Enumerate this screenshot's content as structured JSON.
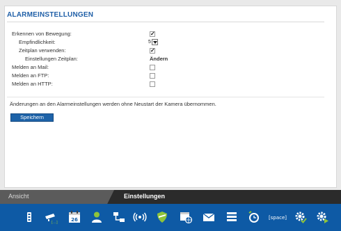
{
  "panel": {
    "title": "ALARMEINSTELLUNGEN",
    "rows": [
      {
        "label": "Erkennen von Bewegung:",
        "control": "checkbox",
        "checked": true,
        "mark": "✓"
      },
      {
        "label": "Empfindlichkeit:",
        "control": "spinner",
        "value": "5"
      },
      {
        "label": "Zeitplan verwenden:",
        "control": "checkbox",
        "checked": true,
        "mark": "✓"
      },
      {
        "label": "Einstellungen Zeitplan:",
        "control": "link",
        "value": "Ändern"
      },
      {
        "label": "Melden an Mail:",
        "control": "checkbox",
        "checked": false,
        "mark": ""
      },
      {
        "label": "Melden an FTP:",
        "control": "checkbox",
        "checked": false,
        "mark": ""
      },
      {
        "label": "Melden an HTTP:",
        "control": "checkbox",
        "checked": false,
        "mark": ""
      }
    ],
    "note": "Änderungen an den Alarmeinstellungen werden ohne Neustart der Kamera übernommen.",
    "save_label": "Speichern"
  },
  "tabs": {
    "inactive": "Ansicht",
    "active": "Einstellungen"
  },
  "toolbar": {
    "icons": [
      "device-info-icon",
      "camera-network-icon",
      "calendar-icon",
      "user-icon",
      "network-icon",
      "wireless-icon",
      "shield-icon",
      "browser-globe-icon",
      "mail-icon",
      "storage-list-icon",
      "alarm-clock-icon",
      "space-key-icon",
      "gear-check-icon",
      "gear-play-icon"
    ],
    "calendar_day": "26",
    "space_label": "[space]"
  },
  "colors": {
    "accent": "#1f5fa7",
    "toolbar_bg": "#0e5aa5",
    "icon_green": "#8fc43a"
  }
}
